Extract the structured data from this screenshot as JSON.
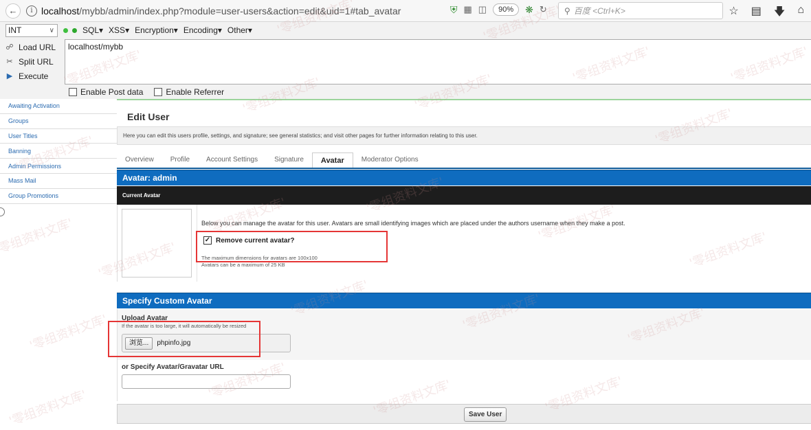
{
  "browser": {
    "url_prefix": "localhost",
    "url_rest": "/mybb/admin/index.php?module=user-users&action=edit&uid=1#tab_avatar",
    "zoom": "90%",
    "search_placeholder": "百度 <Ctrl+K>"
  },
  "hackbar": {
    "select_value": "INT",
    "menus": [
      "SQL",
      "XSS",
      "Encryption",
      "Encoding",
      "Other"
    ],
    "buttons": {
      "load": "Load URL",
      "split": "Split URL",
      "execute": "Execute"
    },
    "url_value": "localhost/mybb",
    "checkboxes": {
      "post": "Enable Post data",
      "referrer": "Enable Referrer"
    }
  },
  "sidebar": {
    "items": [
      {
        "label": "Awaiting Activation"
      },
      {
        "label": "Groups"
      },
      {
        "label": "User Titles"
      },
      {
        "label": "Banning"
      },
      {
        "label": "Admin Permissions"
      },
      {
        "label": "Mass Mail"
      },
      {
        "label": "Group Promotions"
      }
    ]
  },
  "main": {
    "title": "Edit User",
    "description": "Here you can edit this users profile, settings, and signature; see general statistics; and visit other pages for further information relating to this user.",
    "tabs": [
      {
        "label": "Overview",
        "active": false
      },
      {
        "label": "Profile",
        "active": false
      },
      {
        "label": "Account Settings",
        "active": false
      },
      {
        "label": "Signature",
        "active": false
      },
      {
        "label": "Avatar",
        "active": true
      },
      {
        "label": "Moderator Options",
        "active": false
      }
    ],
    "avatar_panel": {
      "title": "Avatar: admin",
      "subheader": "Current Avatar",
      "intro": "Below you can manage the avatar for this user. Avatars are small identifying images which are placed under the authors username when they make a post.",
      "remove_label": "Remove current avatar?",
      "remove_checked": true,
      "dimensions_note": "The maximum dimensions for avatars are 100x100",
      "size_note": "Avatars can be a maximum of 25 KB"
    },
    "custom_panel": {
      "title": "Specify Custom Avatar",
      "upload_label": "Upload Avatar",
      "upload_hint": "If the avatar is too large, it will automatically be resized",
      "browse_label": "浏览...",
      "file_name": "phpinfo.jpg",
      "url_label": "or Specify Avatar/Gravatar URL",
      "url_value": ""
    },
    "save_label": "Save User"
  },
  "watermark": "'零组资料文库'",
  "colors": {
    "panel_blue": "#0f6cbf",
    "subheader": "#1d1d1d",
    "highlight": "#e53535",
    "link": "#2b6bb0"
  }
}
